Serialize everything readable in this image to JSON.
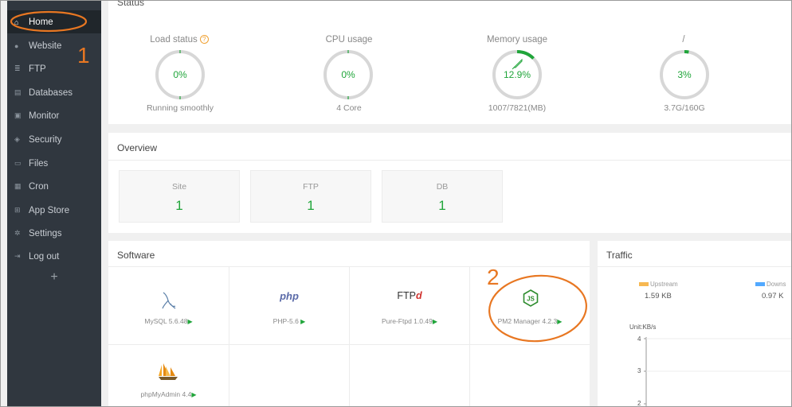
{
  "sidebar": {
    "items": [
      {
        "label": "Home",
        "icon": "home-icon"
      },
      {
        "label": "Website",
        "icon": "globe-icon"
      },
      {
        "label": "FTP",
        "icon": "server-icon"
      },
      {
        "label": "Databases",
        "icon": "database-icon"
      },
      {
        "label": "Monitor",
        "icon": "monitor-icon"
      },
      {
        "label": "Security",
        "icon": "shield-icon"
      },
      {
        "label": "Files",
        "icon": "folder-icon"
      },
      {
        "label": "Cron",
        "icon": "calendar-icon"
      },
      {
        "label": "App Store",
        "icon": "grid-icon"
      },
      {
        "label": "Settings",
        "icon": "gear-icon"
      },
      {
        "label": "Log out",
        "icon": "logout-icon"
      }
    ],
    "add_label": "+"
  },
  "status": {
    "title": "Status",
    "gauges": [
      {
        "label": "Load status",
        "value": "0%",
        "sub": "Running smoothly",
        "fraction": 0.0
      },
      {
        "label": "CPU usage",
        "value": "0%",
        "sub": "4 Core",
        "fraction": 0.0
      },
      {
        "label": "Memory usage",
        "value": "12.9%",
        "sub": "1007/7821(MB)",
        "fraction": 0.129
      },
      {
        "label": "/",
        "value": "3%",
        "sub": "3.7G/160G",
        "fraction": 0.03
      }
    ]
  },
  "overview": {
    "title": "Overview",
    "cards": [
      {
        "label": "Site",
        "value": "1"
      },
      {
        "label": "FTP",
        "value": "1"
      },
      {
        "label": "DB",
        "value": "1"
      }
    ]
  },
  "software": {
    "title": "Software",
    "items": [
      {
        "name": "MySQL 5.6.48",
        "icon": "mysql-dolphin-icon"
      },
      {
        "name": "PHP-5.6",
        "icon": "php-logo-icon",
        "logo_text": "php"
      },
      {
        "name": "Pure-Ftpd 1.0.49",
        "icon": "ftpd-logo-icon",
        "logo_text": "FTP"
      },
      {
        "name": "PM2 Manager 4.2.3",
        "icon": "nodejs-icon"
      },
      {
        "name": "phpMyAdmin 4.4",
        "icon": "phpmyadmin-sailboat-icon"
      }
    ],
    "play": "▶"
  },
  "traffic": {
    "title": "Traffic",
    "upstream_label": "Upstream",
    "upstream_value": "1.59 KB",
    "downstream_label": "Downs",
    "downstream_value": "0.97 K",
    "unit": "Unit:KB/s",
    "y_ticks": [
      "4",
      "3",
      "2"
    ],
    "upstream_color": "#f7b851",
    "downstream_color": "#52a9ff"
  },
  "annotations": {
    "marker1": "1",
    "marker2": "2",
    "color": "#e87722"
  },
  "colors": {
    "sidebar_bg": "#30373f",
    "accent_green": "#20a53a"
  }
}
